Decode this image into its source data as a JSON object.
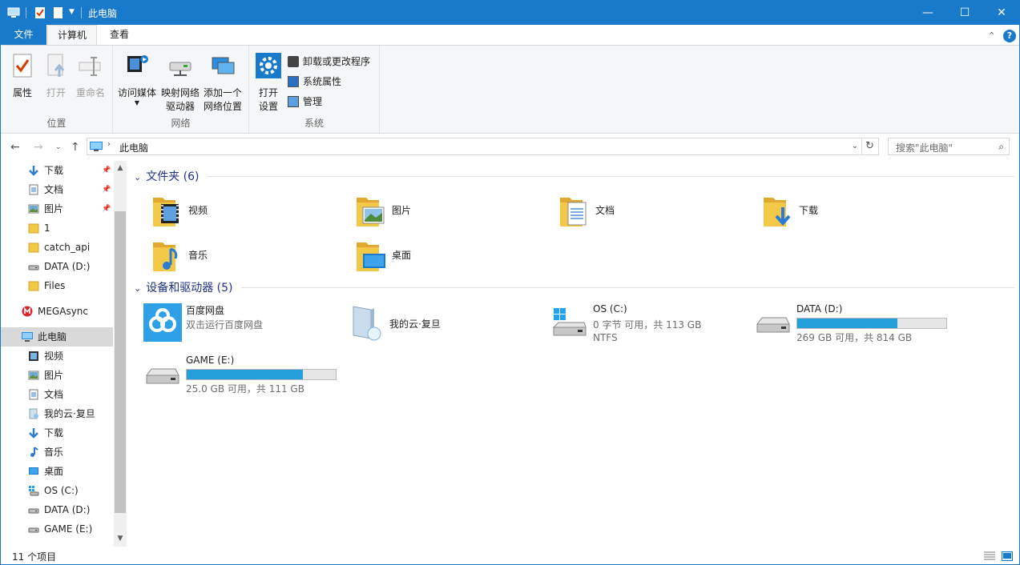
{
  "window": {
    "title": "此电脑"
  },
  "tabs": {
    "file": "文件",
    "computer": "计算机",
    "view": "查看"
  },
  "ribbon": {
    "location": {
      "label": "位置",
      "properties": "属性",
      "open": "打开",
      "rename": "重命名"
    },
    "network": {
      "label": "网络",
      "access_media": "访问媒体",
      "map_drive_1": "映射网络",
      "map_drive_2": "驱动器",
      "add_location_1": "添加一个",
      "add_location_2": "网络位置"
    },
    "system": {
      "label": "系统",
      "open_settings_1": "打开",
      "open_settings_2": "设置",
      "uninstall": "卸载或更改程序",
      "sys_props": "系统属性",
      "manage": "管理"
    }
  },
  "address": {
    "path": "此电脑",
    "search_placeholder": "搜索\"此电脑\""
  },
  "nav": {
    "quick": [
      {
        "label": "下载",
        "icon": "download-arrow-icon",
        "pinned": true
      },
      {
        "label": "文档",
        "icon": "document-icon",
        "pinned": true
      },
      {
        "label": "图片",
        "icon": "picture-icon",
        "pinned": true
      },
      {
        "label": "1",
        "icon": "folder-icon"
      },
      {
        "label": "catch_api",
        "icon": "folder-icon"
      },
      {
        "label": "DATA (D:)",
        "icon": "drive-icon"
      },
      {
        "label": "Files",
        "icon": "folder-icon"
      }
    ],
    "mega": "MEGAsync",
    "thispc": "此电脑",
    "pc_items": [
      {
        "label": "视频",
        "icon": "video-icon"
      },
      {
        "label": "图片",
        "icon": "picture-icon"
      },
      {
        "label": "文档",
        "icon": "document-icon"
      },
      {
        "label": "我的云·复旦",
        "icon": "cloud-book-icon"
      },
      {
        "label": "下载",
        "icon": "download-arrow-icon"
      },
      {
        "label": "音乐",
        "icon": "music-note-icon"
      },
      {
        "label": "桌面",
        "icon": "desktop-icon"
      },
      {
        "label": "OS (C:)",
        "icon": "windows-drive-icon"
      },
      {
        "label": "DATA (D:)",
        "icon": "drive-icon"
      },
      {
        "label": "GAME (E:)",
        "icon": "drive-icon"
      }
    ]
  },
  "content": {
    "folders_header": "文件夹 (6)",
    "folders": [
      {
        "name": "视频",
        "icon": "video-folder-icon"
      },
      {
        "name": "图片",
        "icon": "picture-folder-icon"
      },
      {
        "name": "文档",
        "icon": "document-folder-icon"
      },
      {
        "name": "下载",
        "icon": "download-folder-icon"
      },
      {
        "name": "音乐",
        "icon": "music-folder-icon"
      },
      {
        "name": "桌面",
        "icon": "desktop-folder-icon"
      }
    ],
    "devices_header": "设备和驱动器 (5)",
    "devices": [
      {
        "name": "百度网盘",
        "sub": "双击运行百度网盘",
        "icon": "baidu-netdisk-icon"
      },
      {
        "name": "我的云·复旦",
        "icon": "cloud-book-icon"
      },
      {
        "name": "OS (C:)",
        "sub": "0 字节 可用，共 113 GB",
        "sub2": "NTFS",
        "icon": "windows-drive-icon"
      },
      {
        "name": "DATA (D:)",
        "sub": "269 GB 可用，共 814 GB",
        "used_fraction": 0.67,
        "icon": "drive-icon"
      },
      {
        "name": "GAME (E:)",
        "sub": "25.0 GB 可用，共 111 GB",
        "used_fraction": 0.78,
        "icon": "drive-icon"
      }
    ]
  },
  "status": {
    "count": "11 个项目"
  },
  "colors": {
    "accent": "#1979ca",
    "bar": "#26a0da",
    "folder": "#f3c846",
    "nav_selected": "#d9d9d9"
  }
}
